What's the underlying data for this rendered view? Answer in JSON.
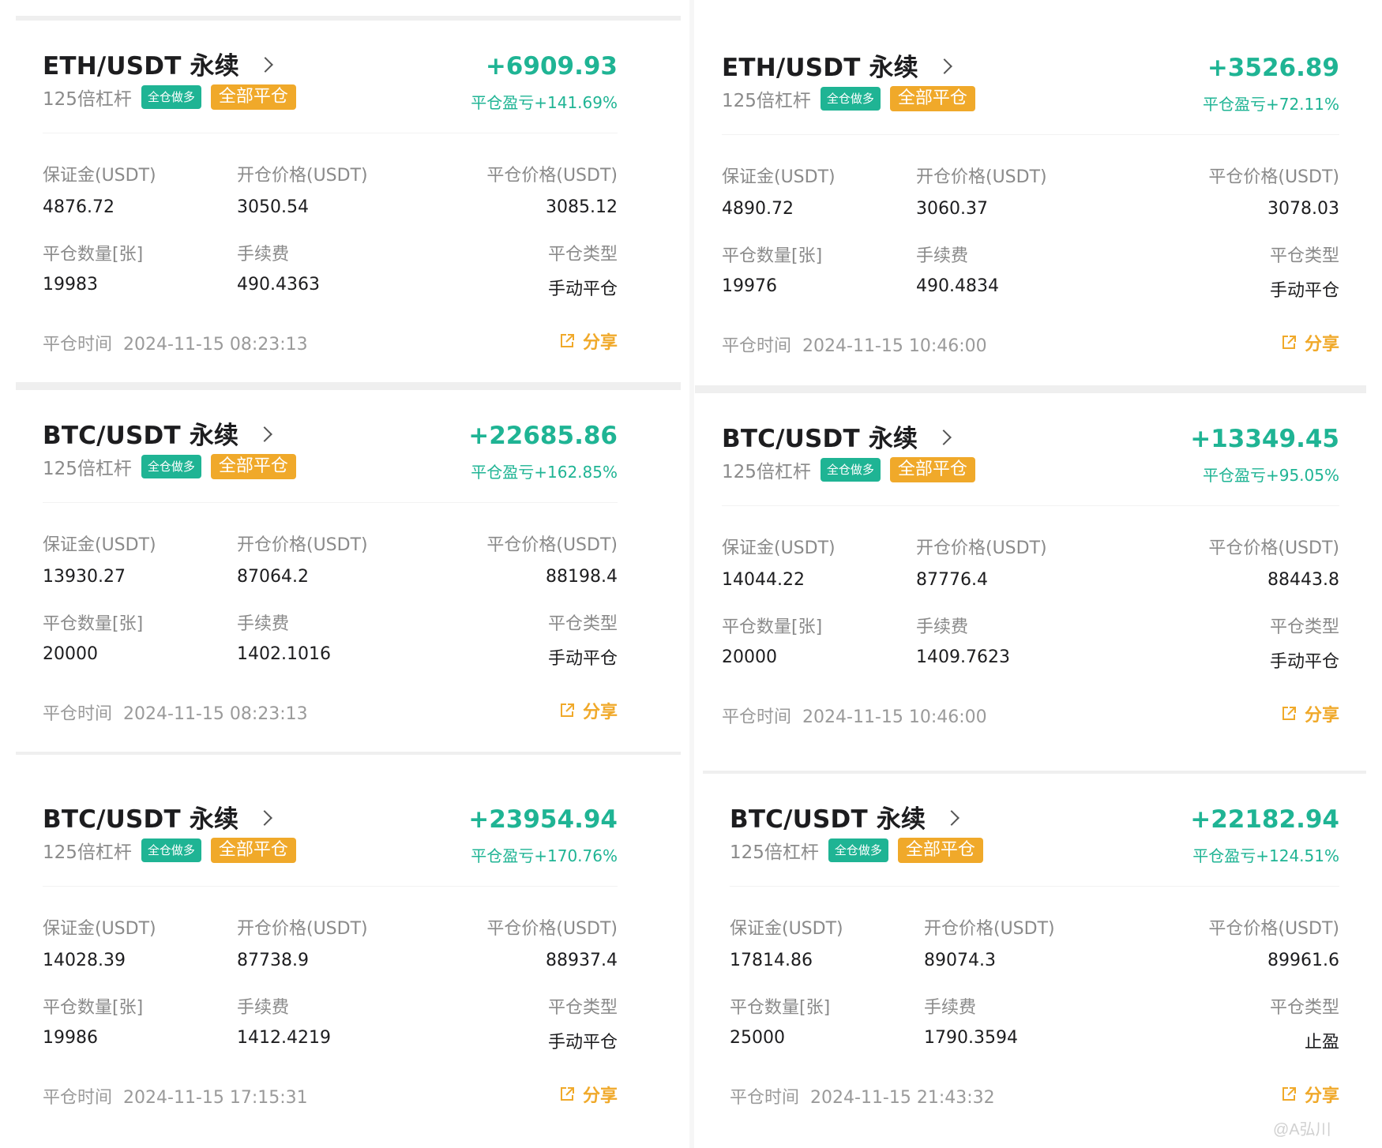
{
  "common": {
    "leverage": "125倍杠杆",
    "position_tag": "全仓做多",
    "close_all": "全部平仓",
    "pnl_label": "平仓盈亏",
    "labels": {
      "margin": "保证金(USDT)",
      "open_price": "开仓价格(USDT)",
      "close_price": "平仓价格(USDT)",
      "close_qty": "平仓数量[张]",
      "fee": "手续费",
      "close_type": "平仓类型",
      "close_time": "平仓时间"
    },
    "share": "分享"
  },
  "cards": [
    {
      "title": "ETH/USDT 永续",
      "pnl": "+6909.93",
      "pnl_pct": "平仓盈亏+141.69%",
      "margin": "4876.72",
      "open_price": "3050.54",
      "close_price": "3085.12",
      "qty": "19983",
      "fee": "490.4363",
      "close_type": "手动平仓",
      "time": "2024-11-15 08:23:13"
    },
    {
      "title": "ETH/USDT 永续",
      "pnl": "+3526.89",
      "pnl_pct": "平仓盈亏+72.11%",
      "margin": "4890.72",
      "open_price": "3060.37",
      "close_price": "3078.03",
      "qty": "19976",
      "fee": "490.4834",
      "close_type": "手动平仓",
      "time": "2024-11-15 10:46:00"
    },
    {
      "title": "BTC/USDT 永续",
      "pnl": "+22685.86",
      "pnl_pct": "平仓盈亏+162.85%",
      "margin": "13930.27",
      "open_price": "87064.2",
      "close_price": "88198.4",
      "qty": "20000",
      "fee": "1402.1016",
      "close_type": "手动平仓",
      "time": "2024-11-15 08:23:13"
    },
    {
      "title": "BTC/USDT 永续",
      "pnl": "+13349.45",
      "pnl_pct": "平仓盈亏+95.05%",
      "margin": "14044.22",
      "open_price": "87776.4",
      "close_price": "88443.8",
      "qty": "20000",
      "fee": "1409.7623",
      "close_type": "手动平仓",
      "time": "2024-11-15 10:46:00"
    },
    {
      "title": "BTC/USDT 永续",
      "pnl": "+23954.94",
      "pnl_pct": "平仓盈亏+170.76%",
      "margin": "14028.39",
      "open_price": "87738.9",
      "close_price": "88937.4",
      "qty": "19986",
      "fee": "1412.4219",
      "close_type": "手动平仓",
      "time": "2024-11-15 17:15:31"
    },
    {
      "title": "BTC/USDT 永续",
      "pnl": "+22182.94",
      "pnl_pct": "平仓盈亏+124.51%",
      "margin": "17814.86",
      "open_price": "89074.3",
      "close_price": "89961.6",
      "qty": "25000",
      "fee": "1790.3594",
      "close_type": "止盈",
      "time": "2024-11-15 21:43:32"
    }
  ],
  "watermark": "@A弘川",
  "colors": {
    "green": "#1fb494",
    "orange": "#f0a92a",
    "muted": "#8a8a8a",
    "text": "#1d1d1f"
  }
}
